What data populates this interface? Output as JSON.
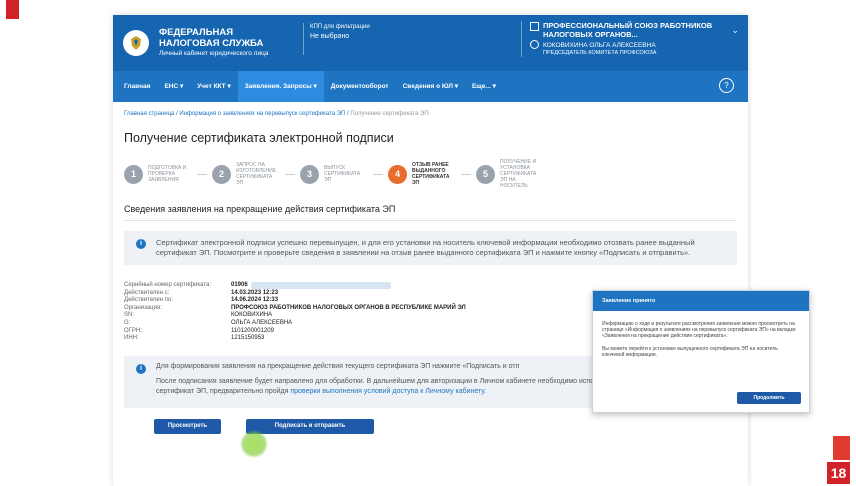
{
  "slide": {
    "number": "18"
  },
  "header": {
    "org_name_line1": "ФЕДЕРАЛЬНАЯ",
    "org_name_line2": "НАЛОГОВАЯ СЛУЖБА",
    "subtitle": "Личный кабинет юридического лица",
    "kpp_label": "КПП для фильтрации",
    "kpp_value": "Не выбрано",
    "account_org": "ПРОФЕССИОНАЛЬНЫЙ СОЮЗ РАБОТНИКОВ НАЛОГОВЫХ ОРГАНОВ...",
    "account_name": "КОКОВИХИНА ОЛЬГА АЛЕКСЕЕВНА",
    "account_role": "ПРЕДСЕДАТЕЛЬ КОМИТЕТА ПРОФСОЮЗА"
  },
  "nav": {
    "items": [
      "Главная",
      "ЕНС ▾",
      "Учет ККТ ▾",
      "Заявления. Запросы ▾",
      "Документооборот",
      "Сведения о ЮЛ ▾",
      "Еще... ▾"
    ],
    "help": "?"
  },
  "breadcrumb": {
    "home": "Главная страница",
    "sep": " / ",
    "middle": "Информация о заявлениях на перевыпуск сертификата ЭП",
    "current": "Получение сертификата ЭП"
  },
  "page_title": "Получение сертификата электронной подписи",
  "steps": [
    {
      "num": "1",
      "label": "Подготовка и проверка заявления"
    },
    {
      "num": "2",
      "label": "Запрос на изготовление сертификата ЭП"
    },
    {
      "num": "3",
      "label": "Выпуск сертификата ЭП"
    },
    {
      "num": "4",
      "label": "Отзыв ранее выданного сертификата ЭП"
    },
    {
      "num": "5",
      "label": "Получение и установка сертификата ЭП на носитель"
    }
  ],
  "section_title": "Сведения заявления на прекращение действия сертификата ЭП",
  "info1": "Сертификат электронной подписи успешно перевыпущен, и для его установки на носитель ключевой информации необходимо отозвать ранее выданный сертификат ЭП. Посмотрите и проверьте сведения в заявлении на отзыв ранее выданного сертификата ЭП и нажмите кнопку «Подписать и отправить».",
  "cert": {
    "serial_label": "Серийный номер сертификата:",
    "serial_value": "01906",
    "valid_from_label": "Действителен с:",
    "valid_from": "14.03.2023 12:23",
    "valid_to_label": "Действителен по:",
    "valid_to": "14.06.2024 12:33",
    "org_label": "Организация:",
    "org": "ПРОФСОЮЗ РАБОТНИКОВ НАЛОГОВЫХ ОРГАНОВ В РЕСПУБЛИКЕ МАРИЙ ЭЛ",
    "sn_label": "SN:",
    "sn": "КОКОВИХИНА",
    "g_label": "G:",
    "g": "ОЛЬГА АЛЕКСЕЕВНА",
    "ogrn_label": "ОГРН:",
    "ogrn": "1101200001209",
    "inn_label": "ИНН:",
    "inn": "1215150953"
  },
  "info2": {
    "p1": "Для формирования заявления на прекращение действия текущего сертификата ЭП нажмите «Подписать и отп",
    "p2": "После подписания заявление будет направлено для обработки. В дальнейшем для авторизации в Личном кабинете необходимо использовать новый выпущенный сертификат ЭП, предварительно пройдя ",
    "link": "проверки выполнения условий доступа к Личному кабинету."
  },
  "buttons": {
    "view": "Просмотреть",
    "sign": "Подписать и отправить"
  },
  "modal": {
    "title": "Заявление принято",
    "p1": "Информацию о ходе и результате рассмотрения заявления можно просмотреть на странице «Информация о заявлениях на перевыпуск сертификата ЭП» на вкладке «Заявления на прекращение действия сертификата».",
    "p2": "Вы можете перейти к установке выпущенного сертификата ЭП на носитель ключевой информации.",
    "button": "Продолжить"
  }
}
